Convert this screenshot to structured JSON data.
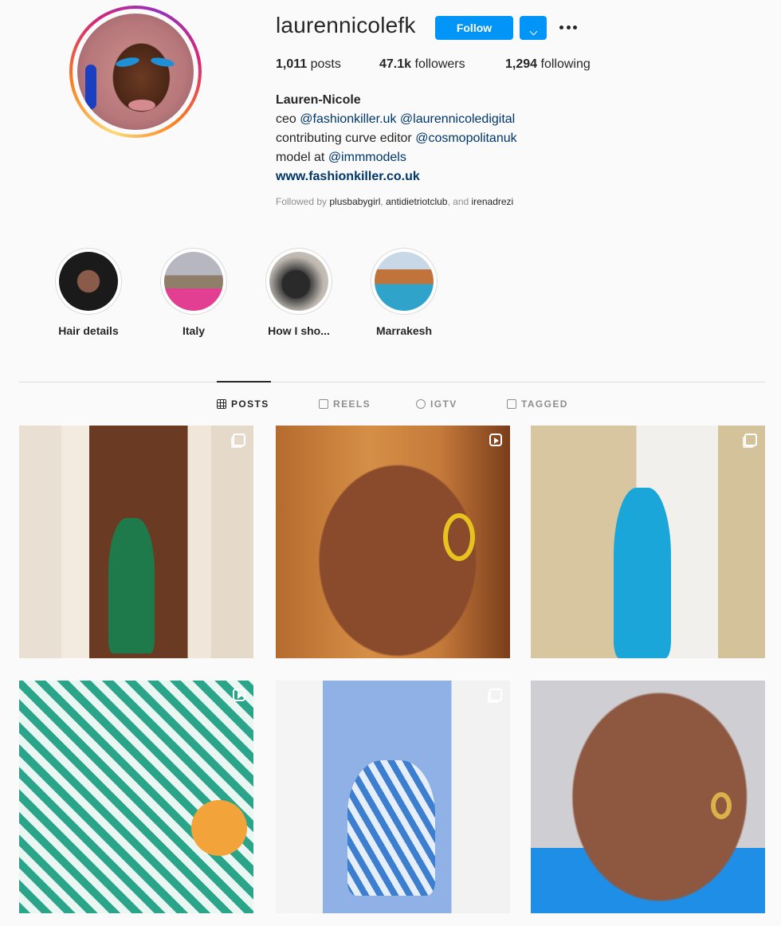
{
  "profile": {
    "username": "laurennicolefk",
    "follow_label": "Follow",
    "stats": {
      "posts_count": "1,011",
      "posts_label": " posts",
      "followers_count": "47.1k",
      "followers_label": " followers",
      "following_count": "1,294",
      "following_label": " following"
    },
    "bio": {
      "name": "Lauren-Nicole",
      "line1_prefix": "ceo ",
      "line1_link1": "@fashionkiller.uk",
      "line1_link2": "@laurennicoledigital",
      "line2_prefix": "contributing curve editor ",
      "line2_link": "@cosmopolitanuk",
      "line3_prefix": "model at ",
      "line3_link": "@immmodels",
      "website": "www.fashionkiller.co.uk"
    },
    "followed_by": {
      "prefix": "Followed by ",
      "user1": "plusbabygirl",
      "sep1": ", ",
      "user2": "antidietriotclub",
      "sep2": ", and ",
      "user3": "irenadrezi"
    }
  },
  "highlights": [
    {
      "label": "Hair details"
    },
    {
      "label": "Italy"
    },
    {
      "label": "How I sho..."
    },
    {
      "label": "Marrakesh"
    }
  ],
  "tabs": [
    {
      "label": "POSTS",
      "icon": "grid-icon",
      "active": true
    },
    {
      "label": "REELS",
      "icon": "reels-icon",
      "active": false
    },
    {
      "label": "IGTV",
      "icon": "igtv-icon",
      "active": false
    },
    {
      "label": "TAGGED",
      "icon": "tagged-icon",
      "active": false
    }
  ],
  "posts": [
    {
      "badge": "carousel-icon"
    },
    {
      "badge": "reel-icon"
    },
    {
      "badge": "carousel-icon"
    },
    {
      "badge": "reel-icon"
    },
    {
      "badge": "carousel-icon"
    },
    {
      "badge": ""
    }
  ],
  "colors": {
    "accent": "#0095f6",
    "link": "#00376b",
    "text": "#262626",
    "muted": "#8e8e8e",
    "background": "#fafafa"
  }
}
